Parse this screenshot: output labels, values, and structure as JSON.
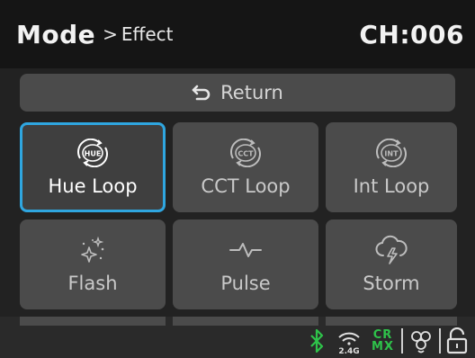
{
  "header": {
    "mode_label": "Mode",
    "separator": ">",
    "submenu": "Effect",
    "channel": "CH:006"
  },
  "return_button": {
    "label": "Return",
    "icon": "return-arrow-icon"
  },
  "tiles": [
    {
      "label": "Hue Loop",
      "icon": "hue-loop-icon",
      "icon_text": "HUE",
      "selected": true
    },
    {
      "label": "CCT Loop",
      "icon": "cct-loop-icon",
      "icon_text": "CCT",
      "selected": false
    },
    {
      "label": "Int Loop",
      "icon": "int-loop-icon",
      "icon_text": "INT",
      "selected": false
    },
    {
      "label": "Flash",
      "icon": "flash-sparkle-icon",
      "selected": false
    },
    {
      "label": "Pulse",
      "icon": "pulse-icon",
      "selected": false
    },
    {
      "label": "Storm",
      "icon": "storm-cloud-icon",
      "selected": false
    }
  ],
  "status_bar": {
    "bluetooth_icon": "bluetooth-icon",
    "wireless_band": "2.4G",
    "crmx_top": "CR",
    "crmx_bottom": "MX",
    "dmx_icon": "dmx-link-icon",
    "lock_icon": "unlocked-padlock-icon"
  },
  "colors": {
    "selection_border": "#2fa6e0",
    "crmx_green": "#2ec24a",
    "bluetooth_green": "#2ec24a",
    "tile_bg": "#4b4b4b"
  }
}
